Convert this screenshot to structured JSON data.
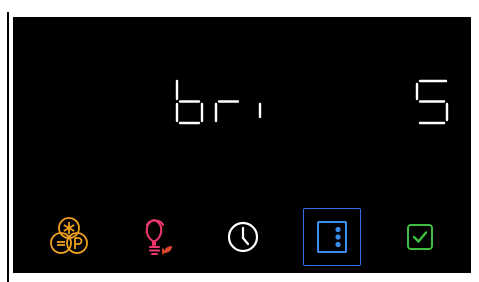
{
  "display": {
    "setting_name": "bri",
    "setting_value": "5"
  },
  "toolbar": {
    "buttons": [
      {
        "icon": "snowflake-p-icon",
        "state": "normal"
      },
      {
        "icon": "lightbulb-leaf-icon",
        "state": "normal"
      },
      {
        "icon": "clock-icon",
        "state": "normal"
      },
      {
        "icon": "door-menu-icon",
        "state": "selected"
      },
      {
        "icon": "checkbox-icon",
        "state": "normal"
      }
    ]
  },
  "colors": {
    "background": "#000000",
    "segment": "#ffffff",
    "favorites": "#f0a020",
    "light": "#f0386e",
    "leaf": "#e0452f",
    "timer": "#ffffff",
    "settings": "#3b8cf0",
    "selected_border": "#2f6fe0",
    "confirm": "#3fbf3f"
  }
}
